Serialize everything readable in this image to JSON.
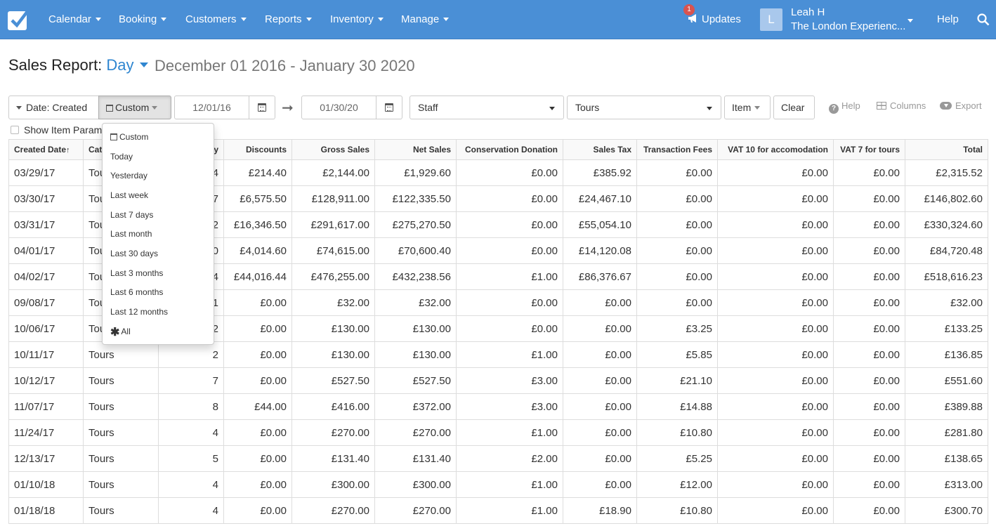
{
  "nav": {
    "menus": [
      "Calendar",
      "Booking",
      "Customers",
      "Reports",
      "Inventory",
      "Manage"
    ],
    "updates_label": "Updates",
    "updates_count": "1",
    "user_initial": "L",
    "user_name": "Leah H",
    "user_org": "The London Experienc...",
    "help_label": "Help"
  },
  "header": {
    "title": "Sales Report:",
    "period": "Day",
    "date_range": "December 01 2016 - January 30 2020"
  },
  "toolbar": {
    "date_filter_label": "Date: Created",
    "date_preset_label": "Custom",
    "start_date": "12/01/16",
    "end_date": "01/30/20",
    "staff_select": "Staff",
    "tours_select": "Tours",
    "item_label": "Item",
    "clear_label": "Clear",
    "help_label": "Help",
    "columns_label": "Columns",
    "export_label": "Export",
    "show_item_params_label": "Show Item Param"
  },
  "date_dropdown": {
    "options": [
      "Custom",
      "Today",
      "Yesterday",
      "Last week",
      "Last 7 days",
      "Last month",
      "Last 30 days",
      "Last 3 months",
      "Last 6 months",
      "Last 12 months",
      "All"
    ]
  },
  "table": {
    "columns": [
      "Created Date",
      "Cate",
      "ty",
      "Discounts",
      "Gross Sales",
      "Net Sales",
      "Conservation Donation",
      "Sales Tax",
      "Transaction Fees",
      "VAT 10 for accomodation",
      "VAT 7 for tours",
      "Total"
    ],
    "sort_indicator": "↑",
    "rows": [
      [
        "03/29/17",
        "Tou",
        "4",
        "£214.40",
        "£2,144.00",
        "£1,929.60",
        "£0.00",
        "£385.92",
        "£0.00",
        "£0.00",
        "£0.00",
        "£2,315.52"
      ],
      [
        "03/30/17",
        "Tou",
        "7",
        "£6,575.50",
        "£128,911.00",
        "£122,335.50",
        "£0.00",
        "£24,467.10",
        "£0.00",
        "£0.00",
        "£0.00",
        "£146,802.60"
      ],
      [
        "03/31/17",
        "Tou",
        "2",
        "£16,346.50",
        "£291,617.00",
        "£275,270.50",
        "£0.00",
        "£55,054.10",
        "£0.00",
        "£0.00",
        "£0.00",
        "£330,324.60"
      ],
      [
        "04/01/17",
        "Tou",
        "0",
        "£4,014.60",
        "£74,615.00",
        "£70,600.40",
        "£0.00",
        "£14,120.08",
        "£0.00",
        "£0.00",
        "£0.00",
        "£84,720.48"
      ],
      [
        "04/02/17",
        "Tou",
        "4",
        "£44,016.44",
        "£476,255.00",
        "£432,238.56",
        "£1.00",
        "£86,376.67",
        "£0.00",
        "£0.00",
        "£0.00",
        "£518,616.23"
      ],
      [
        "09/08/17",
        "Tou",
        "1",
        "£0.00",
        "£32.00",
        "£32.00",
        "£0.00",
        "£0.00",
        "£0.00",
        "£0.00",
        "£0.00",
        "£32.00"
      ],
      [
        "10/06/17",
        "Tou",
        "2",
        "£0.00",
        "£130.00",
        "£130.00",
        "£0.00",
        "£0.00",
        "£3.25",
        "£0.00",
        "£0.00",
        "£133.25"
      ],
      [
        "10/11/17",
        "Tours",
        "2",
        "£0.00",
        "£130.00",
        "£130.00",
        "£1.00",
        "£0.00",
        "£5.85",
        "£0.00",
        "£0.00",
        "£136.85"
      ],
      [
        "10/12/17",
        "Tours",
        "7",
        "£0.00",
        "£527.50",
        "£527.50",
        "£3.00",
        "£0.00",
        "£21.10",
        "£0.00",
        "£0.00",
        "£551.60"
      ],
      [
        "11/07/17",
        "Tours",
        "8",
        "£44.00",
        "£416.00",
        "£372.00",
        "£3.00",
        "£0.00",
        "£14.88",
        "£0.00",
        "£0.00",
        "£389.88"
      ],
      [
        "11/24/17",
        "Tours",
        "4",
        "£0.00",
        "£270.00",
        "£270.00",
        "£1.00",
        "£0.00",
        "£10.80",
        "£0.00",
        "£0.00",
        "£281.80"
      ],
      [
        "12/13/17",
        "Tours",
        "5",
        "£0.00",
        "£131.40",
        "£131.40",
        "£2.00",
        "£0.00",
        "£5.25",
        "£0.00",
        "£0.00",
        "£138.65"
      ],
      [
        "01/10/18",
        "Tours",
        "4",
        "£0.00",
        "£300.00",
        "£300.00",
        "£1.00",
        "£0.00",
        "£12.00",
        "£0.00",
        "£0.00",
        "£313.00"
      ],
      [
        "01/18/18",
        "Tours",
        "4",
        "£0.00",
        "£270.00",
        "£270.00",
        "£1.00",
        "£18.90",
        "£10.80",
        "£0.00",
        "£0.00",
        "£300.70"
      ]
    ]
  }
}
